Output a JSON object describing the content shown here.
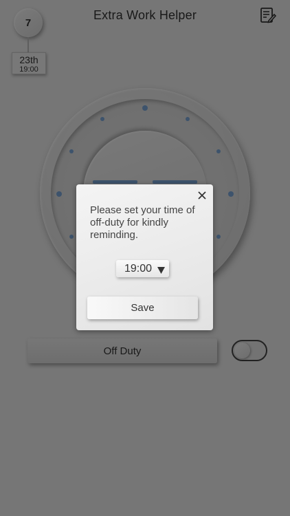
{
  "header": {
    "title": "Extra Work Helper",
    "edit_icon": "edit-note-icon"
  },
  "date_badge": {
    "day": "7",
    "date": "23th",
    "time": "19:00"
  },
  "footer": {
    "off_duty_label": "Off Duty",
    "toggle_on": false
  },
  "modal": {
    "message": "Please set your time of off-duty for kindly reminding.",
    "time_value": "19:00",
    "save_label": "Save",
    "close_icon": "close-icon"
  },
  "colors": {
    "accent": "#7aa7d8",
    "background": "#ececec",
    "overlay": "rgba(0,0,0,0.5)"
  }
}
